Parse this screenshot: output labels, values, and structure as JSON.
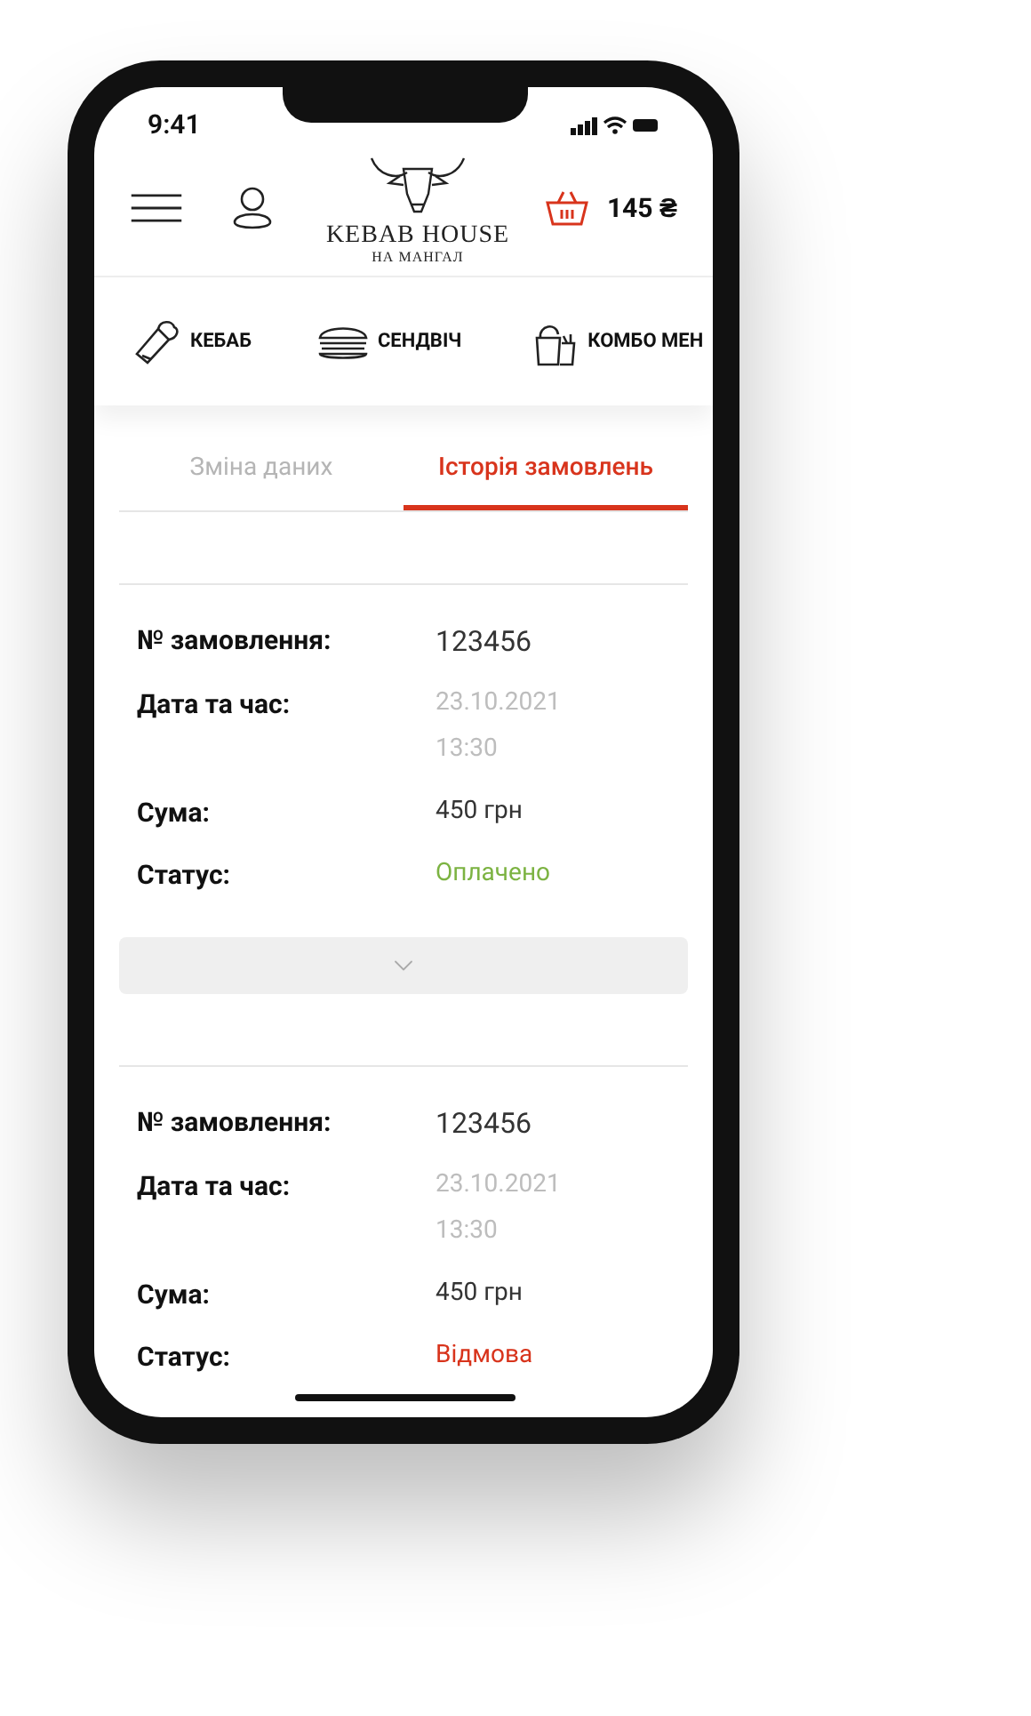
{
  "status_bar": {
    "time": "9:41"
  },
  "header": {
    "logo_title": "KEBAB HOUSE",
    "logo_subtitle": "НА МАНГАЛ",
    "cart_total": "145 ₴"
  },
  "categories": [
    {
      "kind": "wrap",
      "label": "КЕБАБ"
    },
    {
      "kind": "sandwich",
      "label": "СЕНДВІЧ"
    },
    {
      "kind": "combo",
      "label": "КОМБО МЕН"
    }
  ],
  "tabs": [
    {
      "label": "Зміна даних",
      "selected": false
    },
    {
      "label": "Історія замовлень",
      "selected": true
    }
  ],
  "orders": [
    {
      "number_label": "№ замовлення:",
      "number": "123456",
      "date_label": "Дата та час:",
      "date": "23.10.2021",
      "time": "13:30",
      "sum_label": "Сума:",
      "sum": "450 грн",
      "status_label": "Статус:",
      "status": "Оплачено",
      "color": "#7cb342",
      "expanded": false
    },
    {
      "number_label": "№ замовлення:",
      "number": "123456",
      "date_label": "Дата та час:",
      "date": "23.10.2021",
      "time": "13:30",
      "sum_label": "Сума:",
      "sum": "450 грн",
      "status_label": "Статус:",
      "status": "Відмова",
      "color": "#d8341c"
    }
  ]
}
